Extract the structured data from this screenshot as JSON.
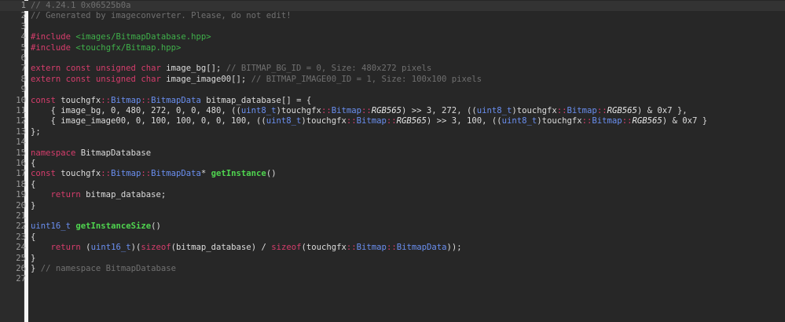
{
  "editor": {
    "background": "#272727",
    "lines": [
      {
        "n": "1",
        "tokens": [
          [
            "c",
            "// 4.24.1 0x06525b0a"
          ]
        ]
      },
      {
        "n": "2",
        "tokens": [
          [
            "c",
            "// Generated by imageconverter. Please, do not edit!"
          ]
        ]
      },
      {
        "n": "3",
        "tokens": []
      },
      {
        "n": "4",
        "tokens": [
          [
            "p",
            "#include"
          ],
          [
            "t",
            " "
          ],
          [
            "i",
            "<images/BitmapDatabase.hpp>"
          ]
        ]
      },
      {
        "n": "5",
        "tokens": [
          [
            "p",
            "#include"
          ],
          [
            "t",
            " "
          ],
          [
            "i",
            "<touchgfx/Bitmap.hpp>"
          ]
        ]
      },
      {
        "n": "6",
        "tokens": []
      },
      {
        "n": "7",
        "tokens": [
          [
            "k",
            "extern const unsigned char"
          ],
          [
            "t",
            " image_bg[]; "
          ],
          [
            "c",
            "// BITMAP_BG_ID = 0, Size: 480x272 pixels"
          ]
        ]
      },
      {
        "n": "8",
        "tokens": [
          [
            "k",
            "extern const unsigned char"
          ],
          [
            "t",
            " image_image00[]; "
          ],
          [
            "c",
            "// BITMAP_IMAGE00_ID = 1, Size: 100x100 pixels"
          ]
        ]
      },
      {
        "n": "9",
        "tokens": []
      },
      {
        "n": "10",
        "tokens": [
          [
            "k",
            "const"
          ],
          [
            "t",
            " touchgfx"
          ],
          [
            "s",
            "::"
          ],
          [
            "y",
            "Bitmap"
          ],
          [
            "s",
            "::"
          ],
          [
            "y",
            "BitmapData"
          ],
          [
            "t",
            " bitmap_database[] = {"
          ]
        ]
      },
      {
        "n": "11",
        "tokens": [
          [
            "t",
            "    { image_bg, 0, 480, 272, 0, 0, 480, (("
          ],
          [
            "y",
            "uint8_t"
          ],
          [
            "t",
            ")touchgfx"
          ],
          [
            "s",
            "::"
          ],
          [
            "y",
            "Bitmap"
          ],
          [
            "s",
            "::"
          ],
          [
            "v",
            "RGB565"
          ],
          [
            "t",
            ") >> 3, 272, (("
          ],
          [
            "y",
            "uint8_t"
          ],
          [
            "t",
            ")touchgfx"
          ],
          [
            "s",
            "::"
          ],
          [
            "y",
            "Bitmap"
          ],
          [
            "s",
            "::"
          ],
          [
            "v",
            "RGB565"
          ],
          [
            "t",
            ") & 0x7 },"
          ]
        ]
      },
      {
        "n": "12",
        "tokens": [
          [
            "t",
            "    { image_image00, 0, 100, 100, 0, 0, 100, (("
          ],
          [
            "y",
            "uint8_t"
          ],
          [
            "t",
            ")touchgfx"
          ],
          [
            "s",
            "::"
          ],
          [
            "y",
            "Bitmap"
          ],
          [
            "s",
            "::"
          ],
          [
            "v",
            "RGB565"
          ],
          [
            "t",
            ") >> 3, 100, (("
          ],
          [
            "y",
            "uint8_t"
          ],
          [
            "t",
            ")touchgfx"
          ],
          [
            "s",
            "::"
          ],
          [
            "y",
            "Bitmap"
          ],
          [
            "s",
            "::"
          ],
          [
            "v",
            "RGB565"
          ],
          [
            "t",
            ") & 0x7 }"
          ]
        ]
      },
      {
        "n": "13",
        "tokens": [
          [
            "t",
            "};"
          ]
        ]
      },
      {
        "n": "14",
        "tokens": []
      },
      {
        "n": "15",
        "tokens": [
          [
            "k",
            "namespace"
          ],
          [
            "t",
            " BitmapDatabase"
          ]
        ]
      },
      {
        "n": "16",
        "tokens": [
          [
            "t",
            "{"
          ]
        ]
      },
      {
        "n": "17",
        "tokens": [
          [
            "k",
            "const"
          ],
          [
            "t",
            " touchgfx"
          ],
          [
            "s",
            "::"
          ],
          [
            "y",
            "Bitmap"
          ],
          [
            "s",
            "::"
          ],
          [
            "y",
            "BitmapData"
          ],
          [
            "t",
            "* "
          ],
          [
            "f",
            "getInstance"
          ],
          [
            "t",
            "()"
          ]
        ]
      },
      {
        "n": "18",
        "tokens": [
          [
            "t",
            "{"
          ]
        ]
      },
      {
        "n": "19",
        "tokens": [
          [
            "t",
            "    "
          ],
          [
            "k",
            "return"
          ],
          [
            "t",
            " bitmap_database;"
          ]
        ]
      },
      {
        "n": "20",
        "tokens": [
          [
            "t",
            "}"
          ]
        ]
      },
      {
        "n": "21",
        "tokens": []
      },
      {
        "n": "22",
        "tokens": [
          [
            "y",
            "uint16_t"
          ],
          [
            "t",
            " "
          ],
          [
            "f",
            "getInstanceSize"
          ],
          [
            "t",
            "()"
          ]
        ]
      },
      {
        "n": "23",
        "tokens": [
          [
            "t",
            "{"
          ]
        ]
      },
      {
        "n": "24",
        "tokens": [
          [
            "t",
            "    "
          ],
          [
            "k",
            "return"
          ],
          [
            "t",
            " ("
          ],
          [
            "y",
            "uint16_t"
          ],
          [
            "t",
            ")("
          ],
          [
            "k",
            "sizeof"
          ],
          [
            "t",
            "(bitmap_database) / "
          ],
          [
            "k",
            "sizeof"
          ],
          [
            "t",
            "(touchgfx"
          ],
          [
            "s",
            "::"
          ],
          [
            "y",
            "Bitmap"
          ],
          [
            "s",
            "::"
          ],
          [
            "y",
            "BitmapData"
          ],
          [
            "t",
            "));"
          ]
        ]
      },
      {
        "n": "25",
        "tokens": [
          [
            "t",
            "}"
          ]
        ]
      },
      {
        "n": "26",
        "tokens": [
          [
            "t",
            "} "
          ],
          [
            "c",
            "// namespace BitmapDatabase"
          ]
        ]
      },
      {
        "n": "27",
        "tokens": []
      }
    ],
    "current_line": "1"
  },
  "colors": {
    "comment": "#707070",
    "keyword": "#d63d6c",
    "include_path": "#3fb04a",
    "type": "#6a8ff0",
    "function": "#4fd44f"
  }
}
